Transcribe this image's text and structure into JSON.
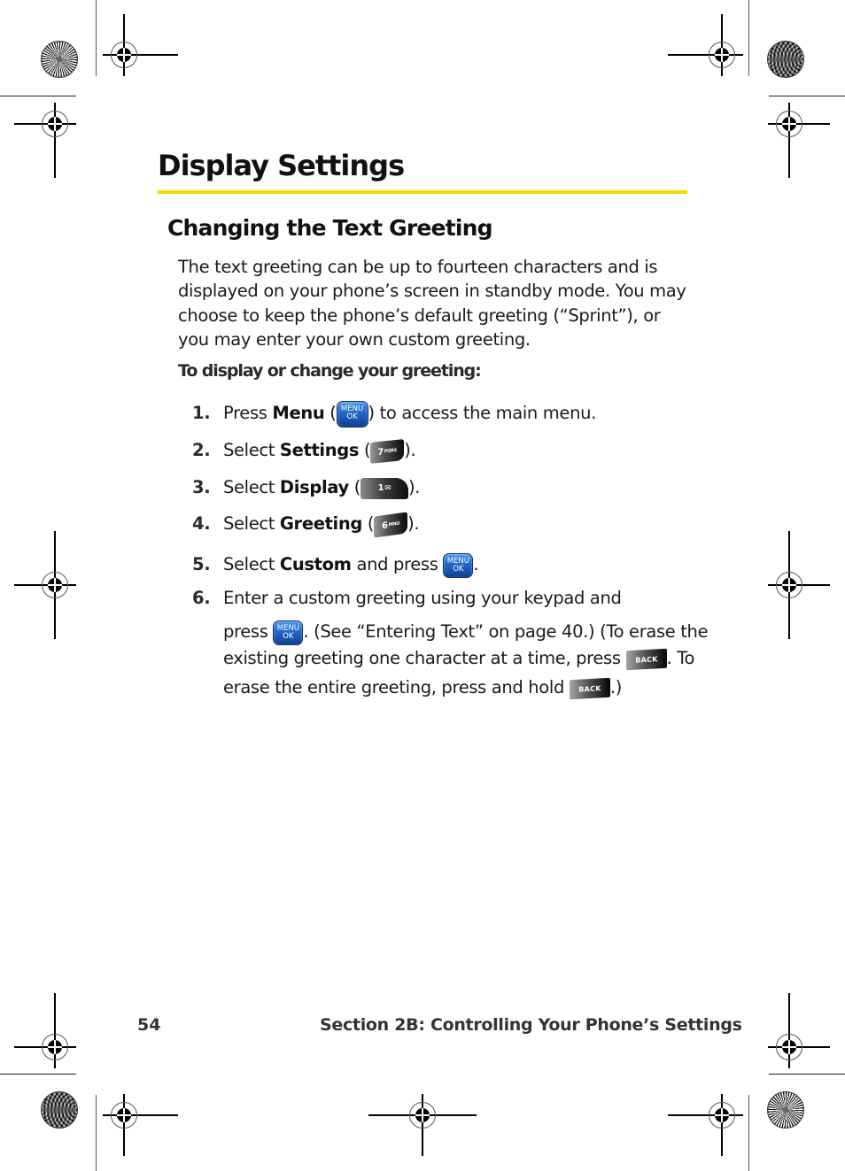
{
  "page": {
    "title": "Display Settings",
    "accent_color": "#f4dc00"
  },
  "section": {
    "heading": "Changing the Text Greeting",
    "intro": "The text greeting can be up to fourteen characters and is displayed on your phone’s screen in standby mode. You may choose to keep the phone’s default greeting (“Sprint”), or you may enter your own custom greeting.",
    "procedure_heading": "To display or change your greeting:"
  },
  "steps": [
    {
      "num": "1.",
      "pre": "Press ",
      "bold": "Menu",
      "mid": " (",
      "key": "menu-ok-key",
      "post": ") to access the main menu."
    },
    {
      "num": "2.",
      "pre": "Select ",
      "bold": "Settings",
      "mid": " (",
      "key": "7-pqrs-key",
      "post": ")."
    },
    {
      "num": "3.",
      "pre": "Select ",
      "bold": "Display",
      "mid": " (",
      "key": "1-voicemail-key",
      "post": ")."
    },
    {
      "num": "4.",
      "pre": "Select ",
      "bold": "Greeting",
      "mid": " (",
      "key": "6-mno-key",
      "post": ")."
    },
    {
      "num": "5.",
      "pre": "Select ",
      "bold": "Custom",
      "mid": " and press ",
      "key": "menu-ok-key",
      "post": "."
    },
    {
      "num": "6.",
      "line1": "Enter a custom greeting using your keypad and",
      "line2_pre": "press ",
      "line2_post": ". (See “Entering Text” on page 40.) (To erase the",
      "line3_pre": "existing greeting one character at a time, press ",
      "line3_post": ". To",
      "line4_pre": "erase the entire greeting, press and hold ",
      "line4_post": ".)"
    }
  ],
  "keys": {
    "menu_top": "MENU",
    "menu_bottom": "OK",
    "key7_digit": "7",
    "key7_letters": "PQRS",
    "key1_digit": "1",
    "key1_symbol": "✉",
    "key6_digit": "6",
    "key6_letters": "MNO",
    "back": "BACK"
  },
  "footer": {
    "page_number": "54",
    "section_title": "Section 2B: Controlling Your Phone’s Settings"
  }
}
